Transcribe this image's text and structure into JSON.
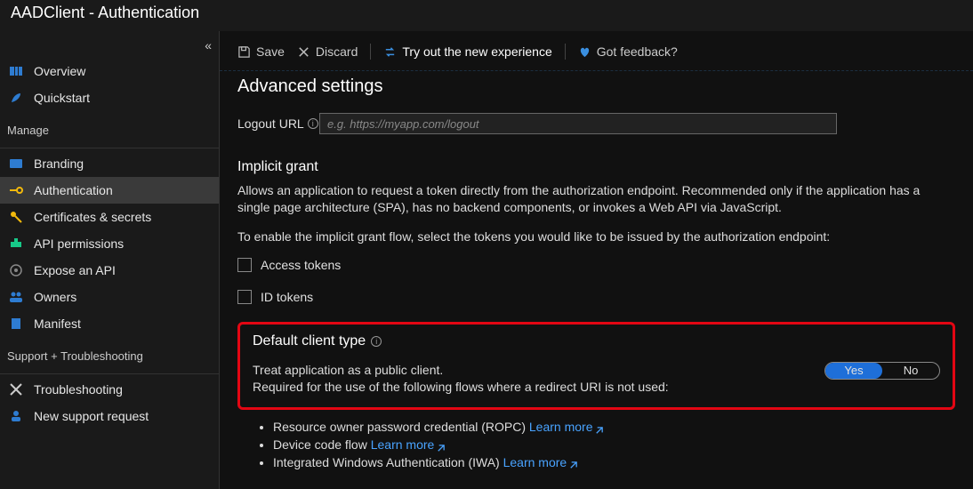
{
  "header": {
    "app": "AADClient",
    "section": "Authentication"
  },
  "sidebar": {
    "top": [
      {
        "label": "Overview"
      },
      {
        "label": "Quickstart"
      }
    ],
    "manage_label": "Manage",
    "manage": [
      {
        "label": "Branding"
      },
      {
        "label": "Authentication"
      },
      {
        "label": "Certificates & secrets"
      },
      {
        "label": "API permissions"
      },
      {
        "label": "Expose an API"
      },
      {
        "label": "Owners"
      },
      {
        "label": "Manifest"
      }
    ],
    "support_label": "Support + Troubleshooting",
    "support": [
      {
        "label": "Troubleshooting"
      },
      {
        "label": "New support request"
      }
    ]
  },
  "toolbar": {
    "save": "Save",
    "discard": "Discard",
    "try_new": "Try out the new experience",
    "feedback": "Got feedback?"
  },
  "advanced": {
    "title": "Advanced settings",
    "logout_label": "Logout URL",
    "logout_placeholder": "e.g. https://myapp.com/logout"
  },
  "implicit": {
    "title": "Implicit grant",
    "desc1": "Allows an application to request a token directly from the authorization endpoint. Recommended only if the application has a single page architecture (SPA), has no backend components, or invokes a Web API via JavaScript.",
    "desc2": "To enable the implicit grant flow, select the tokens you would like to be issued by the authorization endpoint:",
    "chk_access": "Access tokens",
    "chk_id": "ID tokens"
  },
  "dct": {
    "title": "Default client type",
    "line1": "Treat application as a public client.",
    "line2": "Required for the use of the following flows where a redirect URI is not used:",
    "yes": "Yes",
    "no": "No",
    "flows": [
      {
        "text": "Resource owner password credential (ROPC) ",
        "link": "Learn more"
      },
      {
        "text": "Device code flow ",
        "link": "Learn more"
      },
      {
        "text": "Integrated Windows Authentication (IWA) ",
        "link": "Learn more"
      }
    ]
  }
}
